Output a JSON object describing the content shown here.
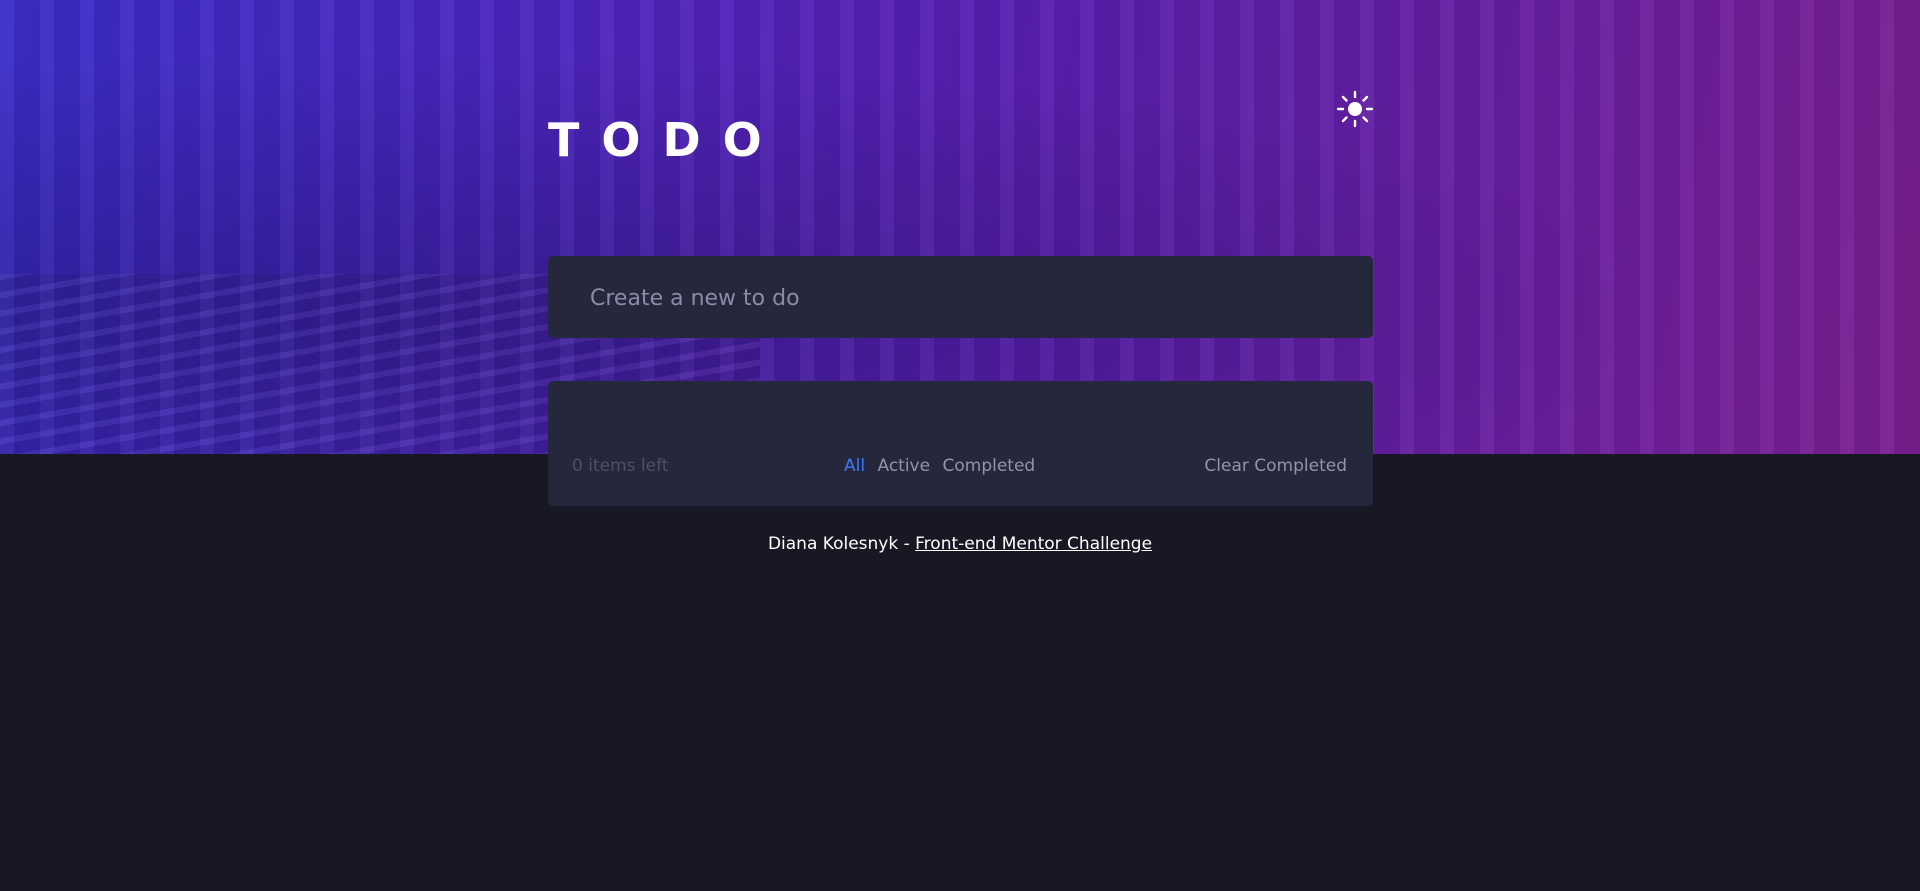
{
  "header": {
    "title": "TODO"
  },
  "theme_toggle": {
    "icon": "sun-icon"
  },
  "new_todo": {
    "placeholder": "Create a new to do",
    "value": ""
  },
  "footer_bar": {
    "items_left": "0 items left",
    "filters": [
      "All",
      "Active",
      "Completed"
    ],
    "active_filter": "All",
    "clear_label": "Clear Completed"
  },
  "attribution": {
    "author": "Diana Kolesnyk",
    "separator": " - ",
    "link_label": "Front-end Mentor Challenge"
  },
  "colors": {
    "background": "#181824",
    "card": "#25273c",
    "accent": "#3a7bfd",
    "muted_text": "#9394a5"
  }
}
